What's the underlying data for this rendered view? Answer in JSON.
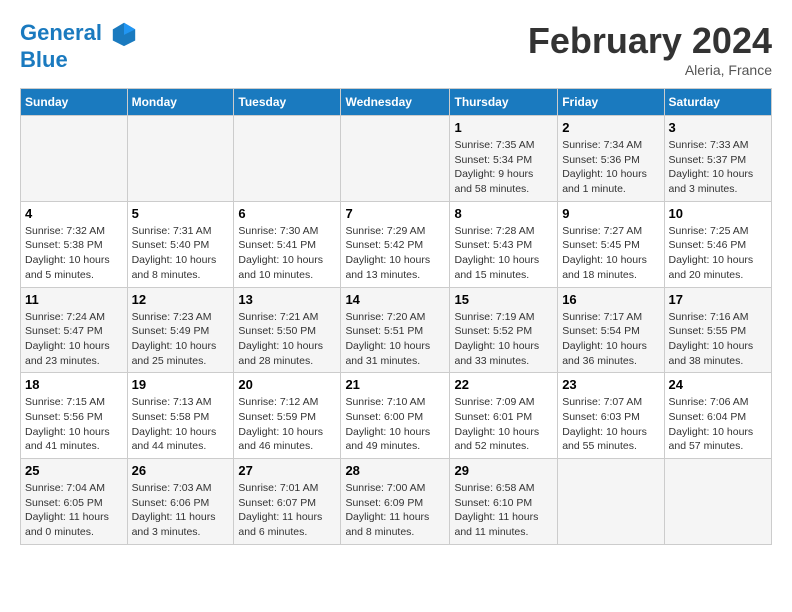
{
  "header": {
    "logo_line1": "General",
    "logo_line2": "Blue",
    "month_title": "February 2024",
    "location": "Aleria, France"
  },
  "weekdays": [
    "Sunday",
    "Monday",
    "Tuesday",
    "Wednesday",
    "Thursday",
    "Friday",
    "Saturday"
  ],
  "weeks": [
    [
      {
        "day": "",
        "sunrise": "",
        "sunset": "",
        "daylight": ""
      },
      {
        "day": "",
        "sunrise": "",
        "sunset": "",
        "daylight": ""
      },
      {
        "day": "",
        "sunrise": "",
        "sunset": "",
        "daylight": ""
      },
      {
        "day": "",
        "sunrise": "",
        "sunset": "",
        "daylight": ""
      },
      {
        "day": "1",
        "sunrise": "Sunrise: 7:35 AM",
        "sunset": "Sunset: 5:34 PM",
        "daylight": "Daylight: 9 hours and 58 minutes."
      },
      {
        "day": "2",
        "sunrise": "Sunrise: 7:34 AM",
        "sunset": "Sunset: 5:36 PM",
        "daylight": "Daylight: 10 hours and 1 minute."
      },
      {
        "day": "3",
        "sunrise": "Sunrise: 7:33 AM",
        "sunset": "Sunset: 5:37 PM",
        "daylight": "Daylight: 10 hours and 3 minutes."
      }
    ],
    [
      {
        "day": "4",
        "sunrise": "Sunrise: 7:32 AM",
        "sunset": "Sunset: 5:38 PM",
        "daylight": "Daylight: 10 hours and 5 minutes."
      },
      {
        "day": "5",
        "sunrise": "Sunrise: 7:31 AM",
        "sunset": "Sunset: 5:40 PM",
        "daylight": "Daylight: 10 hours and 8 minutes."
      },
      {
        "day": "6",
        "sunrise": "Sunrise: 7:30 AM",
        "sunset": "Sunset: 5:41 PM",
        "daylight": "Daylight: 10 hours and 10 minutes."
      },
      {
        "day": "7",
        "sunrise": "Sunrise: 7:29 AM",
        "sunset": "Sunset: 5:42 PM",
        "daylight": "Daylight: 10 hours and 13 minutes."
      },
      {
        "day": "8",
        "sunrise": "Sunrise: 7:28 AM",
        "sunset": "Sunset: 5:43 PM",
        "daylight": "Daylight: 10 hours and 15 minutes."
      },
      {
        "day": "9",
        "sunrise": "Sunrise: 7:27 AM",
        "sunset": "Sunset: 5:45 PM",
        "daylight": "Daylight: 10 hours and 18 minutes."
      },
      {
        "day": "10",
        "sunrise": "Sunrise: 7:25 AM",
        "sunset": "Sunset: 5:46 PM",
        "daylight": "Daylight: 10 hours and 20 minutes."
      }
    ],
    [
      {
        "day": "11",
        "sunrise": "Sunrise: 7:24 AM",
        "sunset": "Sunset: 5:47 PM",
        "daylight": "Daylight: 10 hours and 23 minutes."
      },
      {
        "day": "12",
        "sunrise": "Sunrise: 7:23 AM",
        "sunset": "Sunset: 5:49 PM",
        "daylight": "Daylight: 10 hours and 25 minutes."
      },
      {
        "day": "13",
        "sunrise": "Sunrise: 7:21 AM",
        "sunset": "Sunset: 5:50 PM",
        "daylight": "Daylight: 10 hours and 28 minutes."
      },
      {
        "day": "14",
        "sunrise": "Sunrise: 7:20 AM",
        "sunset": "Sunset: 5:51 PM",
        "daylight": "Daylight: 10 hours and 31 minutes."
      },
      {
        "day": "15",
        "sunrise": "Sunrise: 7:19 AM",
        "sunset": "Sunset: 5:52 PM",
        "daylight": "Daylight: 10 hours and 33 minutes."
      },
      {
        "day": "16",
        "sunrise": "Sunrise: 7:17 AM",
        "sunset": "Sunset: 5:54 PM",
        "daylight": "Daylight: 10 hours and 36 minutes."
      },
      {
        "day": "17",
        "sunrise": "Sunrise: 7:16 AM",
        "sunset": "Sunset: 5:55 PM",
        "daylight": "Daylight: 10 hours and 38 minutes."
      }
    ],
    [
      {
        "day": "18",
        "sunrise": "Sunrise: 7:15 AM",
        "sunset": "Sunset: 5:56 PM",
        "daylight": "Daylight: 10 hours and 41 minutes."
      },
      {
        "day": "19",
        "sunrise": "Sunrise: 7:13 AM",
        "sunset": "Sunset: 5:58 PM",
        "daylight": "Daylight: 10 hours and 44 minutes."
      },
      {
        "day": "20",
        "sunrise": "Sunrise: 7:12 AM",
        "sunset": "Sunset: 5:59 PM",
        "daylight": "Daylight: 10 hours and 46 minutes."
      },
      {
        "day": "21",
        "sunrise": "Sunrise: 7:10 AM",
        "sunset": "Sunset: 6:00 PM",
        "daylight": "Daylight: 10 hours and 49 minutes."
      },
      {
        "day": "22",
        "sunrise": "Sunrise: 7:09 AM",
        "sunset": "Sunset: 6:01 PM",
        "daylight": "Daylight: 10 hours and 52 minutes."
      },
      {
        "day": "23",
        "sunrise": "Sunrise: 7:07 AM",
        "sunset": "Sunset: 6:03 PM",
        "daylight": "Daylight: 10 hours and 55 minutes."
      },
      {
        "day": "24",
        "sunrise": "Sunrise: 7:06 AM",
        "sunset": "Sunset: 6:04 PM",
        "daylight": "Daylight: 10 hours and 57 minutes."
      }
    ],
    [
      {
        "day": "25",
        "sunrise": "Sunrise: 7:04 AM",
        "sunset": "Sunset: 6:05 PM",
        "daylight": "Daylight: 11 hours and 0 minutes."
      },
      {
        "day": "26",
        "sunrise": "Sunrise: 7:03 AM",
        "sunset": "Sunset: 6:06 PM",
        "daylight": "Daylight: 11 hours and 3 minutes."
      },
      {
        "day": "27",
        "sunrise": "Sunrise: 7:01 AM",
        "sunset": "Sunset: 6:07 PM",
        "daylight": "Daylight: 11 hours and 6 minutes."
      },
      {
        "day": "28",
        "sunrise": "Sunrise: 7:00 AM",
        "sunset": "Sunset: 6:09 PM",
        "daylight": "Daylight: 11 hours and 8 minutes."
      },
      {
        "day": "29",
        "sunrise": "Sunrise: 6:58 AM",
        "sunset": "Sunset: 6:10 PM",
        "daylight": "Daylight: 11 hours and 11 minutes."
      },
      {
        "day": "",
        "sunrise": "",
        "sunset": "",
        "daylight": ""
      },
      {
        "day": "",
        "sunrise": "",
        "sunset": "",
        "daylight": ""
      }
    ]
  ]
}
